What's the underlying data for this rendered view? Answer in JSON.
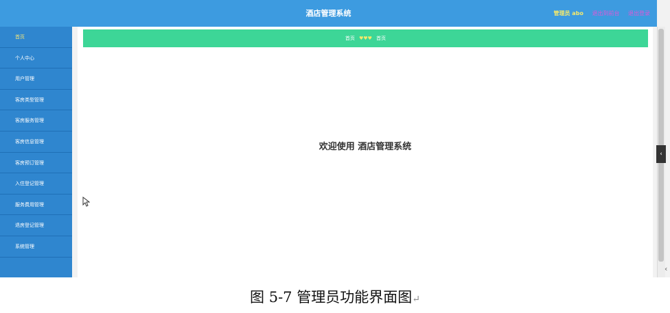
{
  "header": {
    "title": "酒店管理系统",
    "admin_label": "管理员 abo",
    "back_link": "退出到前台",
    "logout_link": "退出登录"
  },
  "sidebar": {
    "items": [
      {
        "label": "首页",
        "active": true
      },
      {
        "label": "个人中心"
      },
      {
        "label": "用户管理"
      },
      {
        "label": "客房类型管理"
      },
      {
        "label": "客房服务管理"
      },
      {
        "label": "客房信息管理"
      },
      {
        "label": "客房预订管理"
      },
      {
        "label": "入住登记管理"
      },
      {
        "label": "服务费用管理"
      },
      {
        "label": "退房登记管理"
      },
      {
        "label": "系统管理"
      }
    ]
  },
  "breadcrumb": {
    "home": "首页",
    "separator": "♥♥♥",
    "current": "首页"
  },
  "main": {
    "welcome": "欢迎使用 酒店管理系统"
  },
  "scroll": {
    "toggle_glyph": "‹"
  },
  "caption": {
    "text": "图 5-7 管理员功能界面图",
    "mark": "↵"
  },
  "colors": {
    "header_bg": "#3d9be0",
    "sidebar_bg": "#2f86cf",
    "breadcrumb_bg": "#3dd697",
    "admin_text": "#f6e96b",
    "link_text": "#e057d6"
  }
}
